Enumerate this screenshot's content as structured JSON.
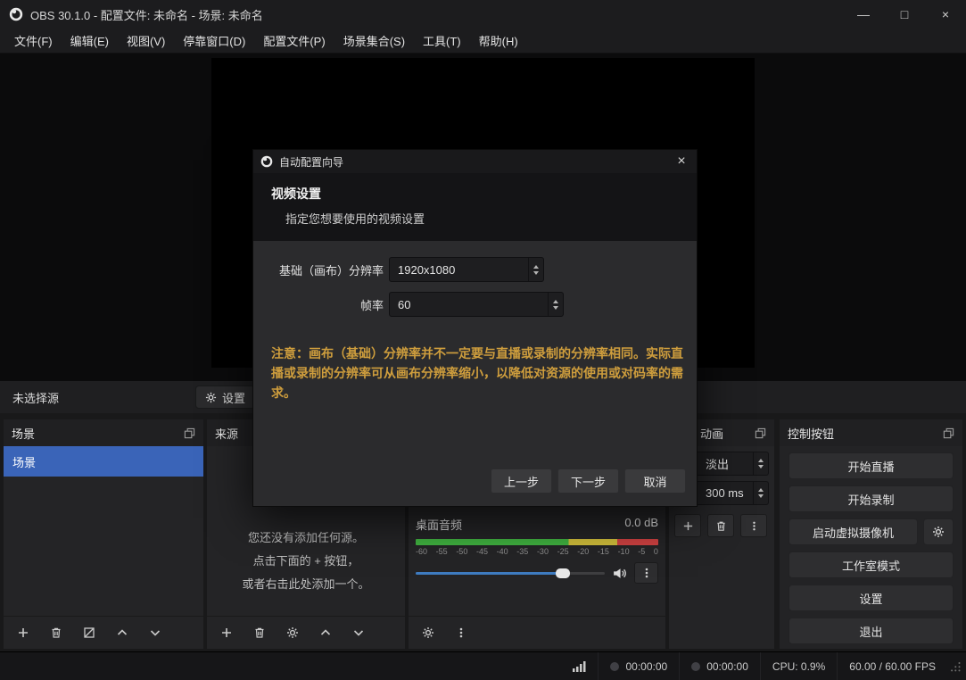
{
  "titlebar": {
    "title": "OBS 30.1.0 - 配置文件: 未命名 - 场景: 未命名",
    "minimize": "—",
    "maximize": "□",
    "close": "×"
  },
  "menu": {
    "items": [
      "文件(F)",
      "编辑(E)",
      "视图(V)",
      "停靠窗口(D)",
      "配置文件(P)",
      "场景集合(S)",
      "工具(T)",
      "帮助(H)"
    ]
  },
  "source_toolbar": {
    "label": "未选择源",
    "settings": "设置"
  },
  "wizard": {
    "title": "自动配置向导",
    "close": "×",
    "heading": "视频设置",
    "subheading": "指定您想要使用的视频设置",
    "fields": [
      {
        "label": "基础（画布）分辨率",
        "value": "1920x1080"
      },
      {
        "label": "帧率",
        "value": "60"
      }
    ],
    "note": "注意：画布（基础）分辨率并不一定要与直播或录制的分辨率相同。实际直播或录制的分辨率可从画布分辨率缩小，以降低对资源的使用或对码率的需求。",
    "back": "上一步",
    "next": "下一步",
    "cancel": "取消"
  },
  "scenes": {
    "title": "场景",
    "items": [
      "场景"
    ]
  },
  "sources": {
    "title": "来源",
    "empty": [
      "您还没有添加任何源。",
      "点击下面的 + 按钮，",
      "或者右击此处添加一个。"
    ]
  },
  "mixer": {
    "source": "桌面音频",
    "level": "0.0 dB",
    "scale": [
      "-60",
      "-55",
      "-50",
      "-45",
      "-40",
      "-35",
      "-30",
      "-25",
      "-20",
      "-15",
      "-10",
      "-5",
      "0"
    ]
  },
  "transitions": {
    "title": "动画",
    "transition": "淡出",
    "duration": "300 ms"
  },
  "controls": {
    "title": "控制按钮",
    "stream": "开始直播",
    "record": "开始录制",
    "vcam": "启动虚拟摄像机",
    "studio": "工作室模式",
    "settings": "设置",
    "exit": "退出"
  },
  "statusbar": {
    "rec_time": "00:00:00",
    "stream_time": "00:00:00",
    "cpu": "CPU: 0.9%",
    "fps": "60.00 / 60.00 FPS"
  },
  "colors": {
    "accent_blue": "#3a64b8",
    "warning_orange": "#cf9e3d",
    "meter_green": "#3faf3f",
    "meter_yellow": "#cdbb3a",
    "meter_red": "#cc4040"
  }
}
